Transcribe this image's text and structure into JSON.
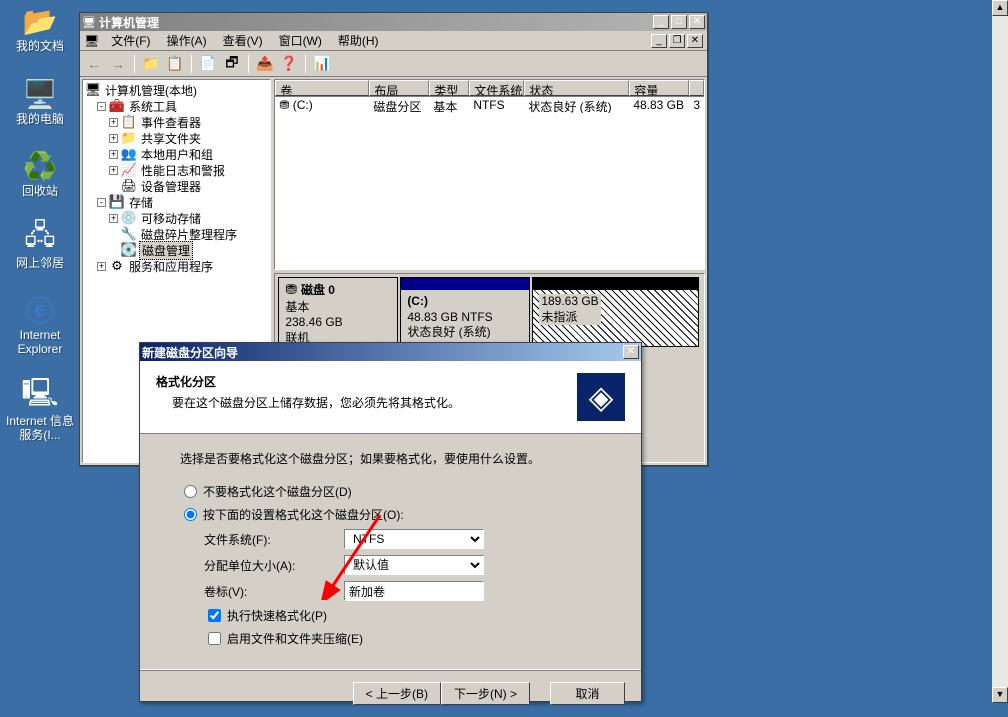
{
  "desktop": [
    {
      "label": "我的文档",
      "emoji": "📁"
    },
    {
      "label": "我的电脑",
      "emoji": "🖥️"
    },
    {
      "label": "回收站",
      "emoji": "🗑️"
    },
    {
      "label": "网上邻居",
      "emoji": "🌐"
    },
    {
      "label": "Internet Explorer",
      "emoji": "🌐"
    },
    {
      "label": "Internet 信息服务(I...",
      "emoji": "🖥️"
    }
  ],
  "mainWindow": {
    "title": "计算机管理",
    "menu": [
      "文件(F)",
      "操作(A)",
      "查看(V)",
      "窗口(W)",
      "帮助(H)"
    ]
  },
  "tree": {
    "root": "计算机管理(本地)",
    "systools": "系统工具",
    "ev": "事件查看器",
    "sf": "共享文件夹",
    "lu": "本地用户和组",
    "pl": "性能日志和警报",
    "dm": "设备管理器",
    "storage": "存储",
    "rs": "可移动存储",
    "dd": "磁盘碎片整理程序",
    "diskmgmt": "磁盘管理",
    "svc": "服务和应用程序"
  },
  "list": {
    "headers": [
      "卷",
      "布局",
      "类型",
      "文件系统",
      "状态",
      "容量",
      ""
    ],
    "row": {
      "vol": "(C:)",
      "layout": "磁盘分区",
      "type": "基本",
      "fs": "NTFS",
      "status": "状态良好 (系统)",
      "cap": "48.83 GB",
      "extra": "3"
    }
  },
  "disk": {
    "label": "磁盘 0",
    "basic": "基本",
    "size": "238.46 GB",
    "online": "联机",
    "c": {
      "name": "(C:)",
      "info1": "48.83 GB NTFS",
      "info2": "状态良好 (系统)"
    },
    "u": {
      "info1": "189.63 GB",
      "info2": "未指派"
    }
  },
  "wizard": {
    "title": "新建磁盘分区向导",
    "headTitle": "格式化分区",
    "headSub": "要在这个磁盘分区上储存数据，您必须先将其格式化。",
    "desc": "选择是否要格式化这个磁盘分区；如果要格式化，要使用什么设置。",
    "radio1": "不要格式化这个磁盘分区(D)",
    "radio2": "按下面的设置格式化这个磁盘分区(O):",
    "fsLabel": "文件系统(F):",
    "fsValue": "NTFS",
    "auLabel": "分配单位大小(A):",
    "auValue": "默认值",
    "volLabel": "卷标(V):",
    "volValue": "新加卷",
    "quick": "执行快速格式化(P)",
    "compress": "启用文件和文件夹压缩(E)",
    "back": "< 上一步(B)",
    "next": "下一步(N) >",
    "cancel": "取消"
  }
}
